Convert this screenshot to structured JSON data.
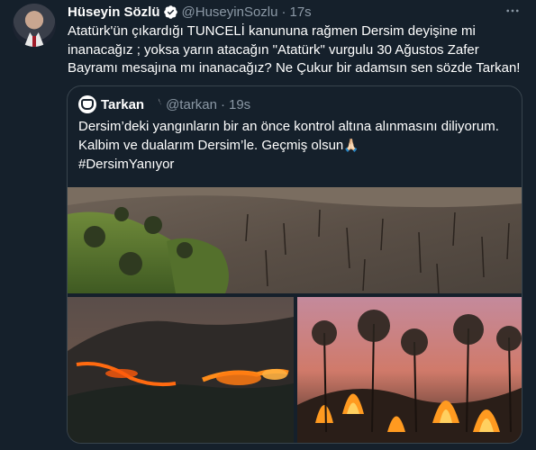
{
  "tweet": {
    "author_name": "Hüseyin Sözlü",
    "author_handle": "@HuseyinSozlu",
    "time": "17s",
    "separator": "·",
    "more_icon": "more-horizontal-icon",
    "text": "Atatürk'ün çıkardığı TUNCELİ kanununa rağmen Dersim  deyişine mi inanacağız ; yoksa yarın atacağın \"Atatürk\" vurgulu 30 Ağustos Zafer Bayramı mesajına mı inanacağız? Ne Çukur bir adamsın sen sözde Tarkan!"
  },
  "quote": {
    "author_name": "Tarkan",
    "author_handle": "@tarkan",
    "time": "19s",
    "separator": "·",
    "line1": "Dersim’deki yangınların bir an önce kontrol altına alınmasını diliyorum.",
    "line2": "Kalbim ve dualarım Dersim’le. Geçmiş olsun",
    "emoji": "🙏🏻",
    "hashtag": "#DersimYanıyor"
  },
  "colors": {
    "background": "#15202b",
    "secondary_text": "#8b98a5",
    "border": "#38444d",
    "verified": "#1d9bf0"
  }
}
